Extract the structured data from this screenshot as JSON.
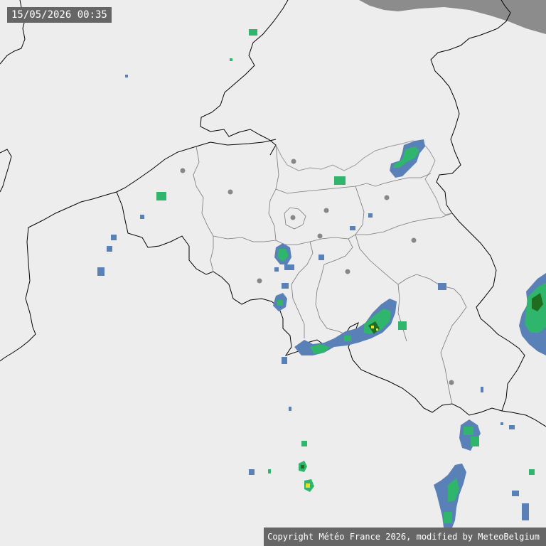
{
  "timestamp": "15/05/2026 00:35",
  "copyright": "Copyright Météo France 2026, modified by MeteoBelgium",
  "colors": {
    "background": "#ededed",
    "sea_corner": "#8c8c8c",
    "border": "#000000",
    "province_line": "#777777",
    "city_dot": "#888888",
    "rain_light": "#5a80b8",
    "rain_moderate": "#2fb56c",
    "rain_heavy": "#1f6e1f",
    "rain_intense": "#e8e030",
    "label_bg": "#666666",
    "label_text": "#ffffff"
  }
}
